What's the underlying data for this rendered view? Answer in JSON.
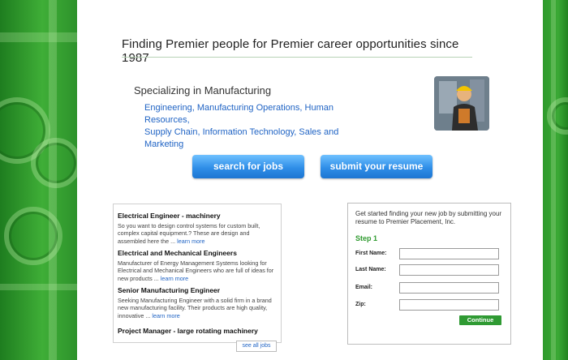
{
  "header": {
    "tagline": "Finding Premier people for Premier career opportunities since 1987"
  },
  "specializing": {
    "title": "Specializing in Manufacturing",
    "links": [
      {
        "label": "Engineering"
      },
      {
        "label": "Manufacturing Operations"
      },
      {
        "label": "Human Resources"
      },
      {
        "label": "Supply Chain"
      },
      {
        "label": "Information Technology"
      },
      {
        "label": "Sales and Marketing"
      }
    ]
  },
  "buttons": {
    "search": "search for jobs",
    "resume": "submit your resume"
  },
  "jobs": {
    "items": [
      {
        "title": "Electrical Engineer - machinery",
        "desc": "So you want to design control systems for custom built, complex capital equipment.? These are design and assembled here the ...",
        "more": "learn more"
      },
      {
        "title": "Electrical and Mechanical Engineers",
        "desc": "Manufacturer of Energy Management Systems looking for Electrical and Mechanical Engineers who are full of ideas for new products ...",
        "more": "learn more"
      },
      {
        "title": "Senior Manufacturing Engineer",
        "desc": "Seeking Manufacturing Engineer with a solid firm in a brand new manufacturing facility. Their products are high quality, innovative ...",
        "more": "learn more"
      },
      {
        "title": "Project Manager - large rotating machinery",
        "desc": "",
        "more": ""
      }
    ],
    "see_all": "see all jobs"
  },
  "form": {
    "intro": "Get started finding your new job by submitting your resume to Premier Placement, Inc.",
    "step": "Step 1",
    "fields": [
      {
        "label": "First Name:",
        "value": ""
      },
      {
        "label": "Last Name:",
        "value": ""
      },
      {
        "label": "Email:",
        "value": ""
      },
      {
        "label": "Zip:",
        "value": ""
      }
    ],
    "continue": "Continue"
  },
  "colors": {
    "brand_green": "#2f9a2c",
    "link_blue": "#1f63c4",
    "button_blue": "#2f8ee8"
  }
}
